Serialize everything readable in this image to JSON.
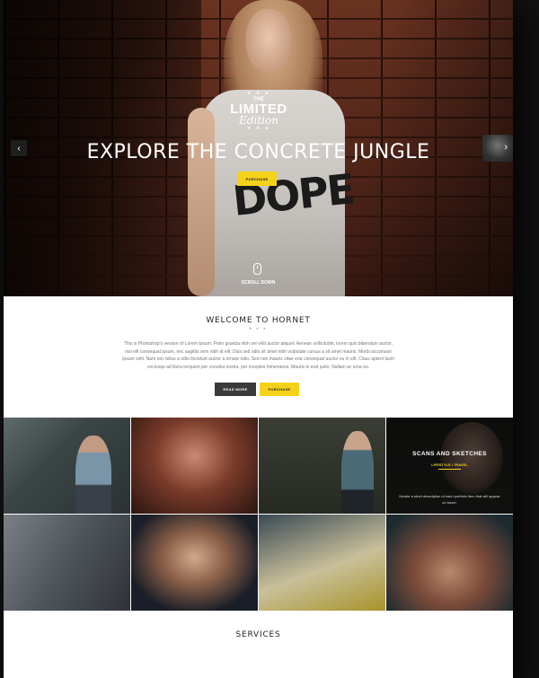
{
  "hero": {
    "logo": {
      "stars": "★ ★ ★",
      "the": "THE",
      "main": "LIMITED",
      "sub": "Edition",
      "stars_bottom": "★ ★ ★"
    },
    "title": "EXPLORE THE CONCRETE JUNGLE",
    "purchase_label": "PURCHASE",
    "prev_icon": "‹",
    "next_icon": "›",
    "scroll_label": "SCROLL DOWN",
    "shirt_print": "DOPE"
  },
  "welcome": {
    "title": "WELCOME TO HORNET",
    "dots": "• • •",
    "text": "This is Photoshop's version of Lorem Ipsum. Proin gravida nibh vel velit auctor aliquet. Aenean sollicitudin, lorem quis bibendum auctor, nisi elit consequat ipsum, nec sagittis sem nibh id elit. Duis sed odio sit amet nibh vulputate cursus a sit amet mauris. Morbi accumsan ipsum velit. Nam nec tellus a odio tincidunt auctor a ornare odio. Sed non mauris vitae erat consequat auctor eu in elit. Class aptent taciti sociosqu ad litora torquent per conubia nostra, per inceptos himenaeos. Mauris in erat justo. Nullam ac urna eu.",
    "read_more_label": "READ MORE",
    "purchase_label": "PURCHASE"
  },
  "portfolio": {
    "featured": {
      "title": "SCANS AND SKETCHES",
      "category": "LIFESTYLE / TRAVEL",
      "description": "Deskle a short description of each portfolio item that will appear on hover."
    }
  },
  "services": {
    "title": "SERVICES"
  },
  "colors": {
    "accent": "#f5d21a",
    "dark_button": "#3a3a3a",
    "page_bg": "#111111"
  }
}
